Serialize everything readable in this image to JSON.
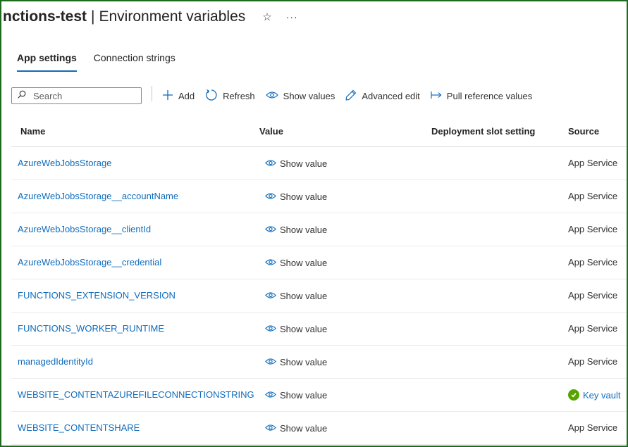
{
  "header": {
    "title_bold": "nctions-test",
    "separator": "|",
    "title_rest": "Environment variables",
    "favorite_glyph": "☆",
    "more_glyph": "···"
  },
  "tabs": [
    {
      "label": "App settings",
      "active": true
    },
    {
      "label": "Connection strings",
      "active": false
    }
  ],
  "toolbar": {
    "search_placeholder": "Search",
    "add": "Add",
    "refresh": "Refresh",
    "show_values": "Show values",
    "advanced_edit": "Advanced edit",
    "pull_reference_values": "Pull reference values"
  },
  "table": {
    "columns": [
      "Name",
      "Value",
      "Deployment slot setting",
      "Source"
    ],
    "rows": [
      {
        "name": "AzureWebJobsStorage",
        "value": "Show value",
        "slot": "",
        "source": "App Service"
      },
      {
        "name": "AzureWebJobsStorage__accountName",
        "value": "Show value",
        "slot": "",
        "source": "App Service"
      },
      {
        "name": "AzureWebJobsStorage__clientId",
        "value": "Show value",
        "slot": "",
        "source": "App Service"
      },
      {
        "name": "AzureWebJobsStorage__credential",
        "value": "Show value",
        "slot": "",
        "source": "App Service"
      },
      {
        "name": "FUNCTIONS_EXTENSION_VERSION",
        "value": "Show value",
        "slot": "",
        "source": "App Service"
      },
      {
        "name": "FUNCTIONS_WORKER_RUNTIME",
        "value": "Show value",
        "slot": "",
        "source": "App Service"
      },
      {
        "name": "managedIdentityId",
        "value": "Show value",
        "slot": "",
        "source": "App Service"
      },
      {
        "name": "WEBSITE_CONTENTAZUREFILECONNECTIONSTRING",
        "value": "Show value",
        "slot": "",
        "source": "Key vault"
      },
      {
        "name": "WEBSITE_CONTENTSHARE",
        "value": "Show value",
        "slot": "",
        "source": "App Service"
      }
    ]
  },
  "colors": {
    "link": "#0f6cbd",
    "frame_border": "#1e6b1e",
    "key_vault_check": "#57a300"
  },
  "icons": {
    "favorite": "star-outline-icon",
    "more": "more-horizontal-icon",
    "search": "search-icon",
    "add": "plus-icon",
    "refresh": "refresh-icon",
    "show_values": "eye-icon",
    "advanced_edit": "pencil-icon",
    "pull_reference": "arrow-pull-icon",
    "key_vault_status": "check-circle-icon"
  }
}
